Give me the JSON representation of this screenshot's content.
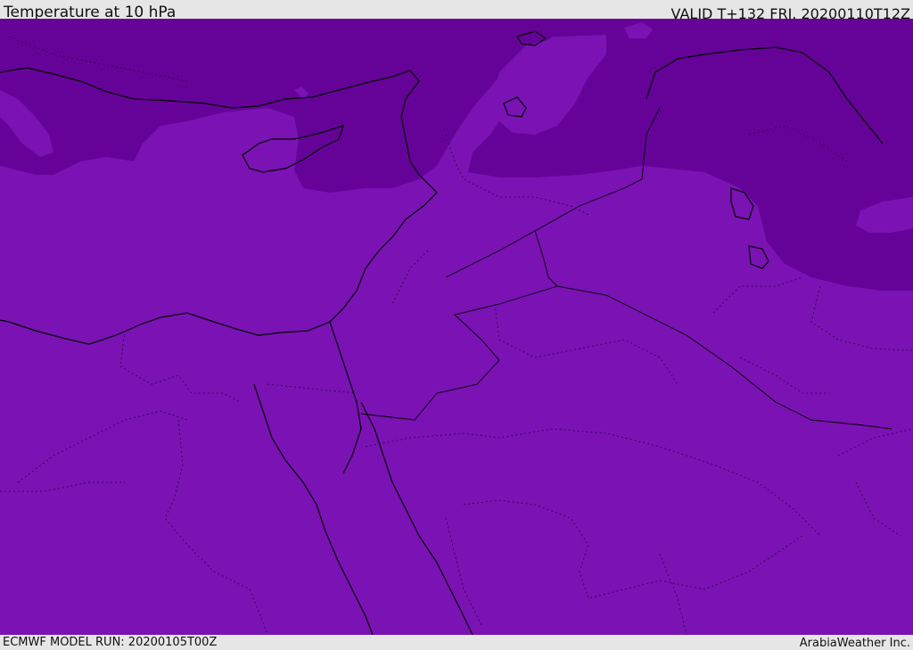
{
  "header": {
    "title": "Temperature at 10 hPa",
    "valid": "VALID T+132 FRI. 20200110T12Z"
  },
  "footer": {
    "model_run": "ECMWF MODEL RUN: 20200105T00Z",
    "credit": "ArabiaWeather Inc."
  },
  "map": {
    "colors": {
      "base_field": "#7a12b4",
      "cold_band": "#650398",
      "mid_band": "#7a12b4",
      "coastline": "#000000",
      "borders_dotted": "#2a0040"
    }
  }
}
